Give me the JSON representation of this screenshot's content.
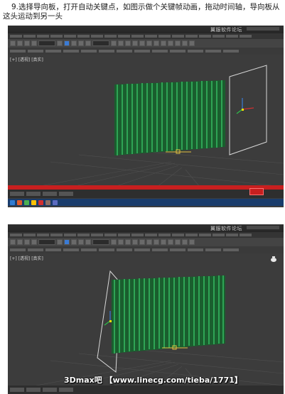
{
  "caption": "9.选择导向板，打开自动关键点，如图示做个关键帧动画，拖动时间轴，导向板从这头运动到另一头",
  "app": {
    "title_brand": "翼服软件论坛"
  },
  "viewport": {
    "label": "[+] [透视] [真实]"
  },
  "watermark": "3Dmax吧 【www.linecg.com/tieba/1771】",
  "colors": {
    "viewport_bg": "#3c3c3c",
    "curtain": "#1f7a3a",
    "auto_key": "#c81f1f"
  }
}
